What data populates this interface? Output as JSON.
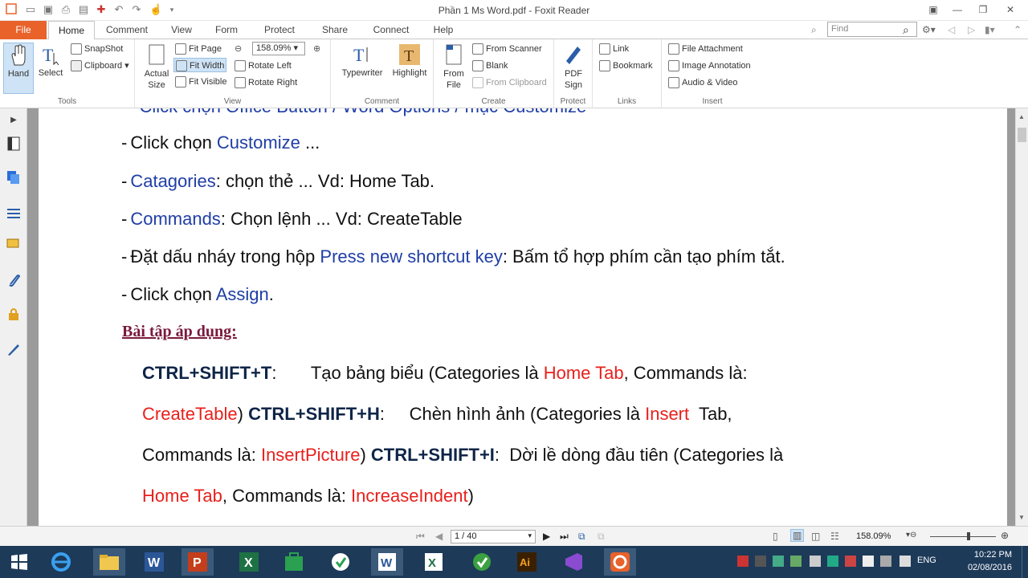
{
  "window": {
    "title": "Phần 1 Ms Word.pdf - Foxit Reader"
  },
  "tabs": [
    "File",
    "Home",
    "Comment",
    "View",
    "Form",
    "Protect",
    "Share",
    "Connect",
    "Help"
  ],
  "search": {
    "placeholder": "Find"
  },
  "ribbon": {
    "tools": {
      "label": "Tools",
      "hand": "Hand",
      "select": "Select",
      "snapshot": "SnapShot",
      "clipboard": "Clipboard"
    },
    "view": {
      "label": "View",
      "actual_size": "Actual Size",
      "fit_page": "Fit Page",
      "fit_width": "Fit Width",
      "fit_visible": "Fit Visible",
      "zoom": "158.09%",
      "rotate_left": "Rotate Left",
      "rotate_right": "Rotate Right"
    },
    "comment": {
      "label": "Comment",
      "typewriter": "Typewriter",
      "highlight": "Highlight"
    },
    "create": {
      "label": "Create",
      "from_file": "From File",
      "from_scanner": "From Scanner",
      "blank": "Blank",
      "from_clipboard": "From Clipboard"
    },
    "protect": {
      "label": "Protect",
      "pdf_sign": "PDF Sign"
    },
    "links": {
      "label": "Links",
      "link": "Link",
      "bookmark": "Bookmark"
    },
    "insert": {
      "label": "Insert",
      "file_attachment": "File Attachment",
      "image_annotation": "Image Annotation",
      "audio_video": "Audio & Video"
    }
  },
  "document": {
    "partial_top": "Click chọn Office Button / Word Options / mục Customize",
    "items": [
      {
        "bullet": "-",
        "parts": [
          {
            "t": "Click chọn ",
            "c": "k"
          },
          {
            "t": "Customize",
            "c": "b"
          },
          {
            "t": " ...",
            "c": "k"
          }
        ]
      },
      {
        "bullet": "-",
        "parts": [
          {
            "t": "Catagories",
            "c": "b"
          },
          {
            "t": ": chọn thẻ ... Vd: Home Tab.",
            "c": "k"
          }
        ]
      },
      {
        "bullet": "-",
        "parts": [
          {
            "t": "Commands",
            "c": "b"
          },
          {
            "t": ": Chọn lệnh ... Vd: CreateTable",
            "c": "k"
          }
        ]
      },
      {
        "bullet": "-",
        "parts": [
          {
            "t": "Đặt dấu nháy trong hộp ",
            "c": "k"
          },
          {
            "t": "Press new shortcut key",
            "c": "b"
          },
          {
            "t": ": Bấm tổ hợp phím cần tạo phím tắt.",
            "c": "k"
          }
        ]
      },
      {
        "bullet": "-",
        "parts": [
          {
            "t": "Click chọn ",
            "c": "k"
          },
          {
            "t": "Assign",
            "c": "b"
          },
          {
            "t": ".",
            "c": "k"
          }
        ]
      }
    ],
    "heading": "Bài tập áp dụng:",
    "exercise_lines": [
      [
        {
          "t": "CTRL+SHIFT+T",
          "c": "s"
        },
        {
          "t": ":       Tạo bảng biểu (Categories là ",
          "c": "k"
        },
        {
          "t": "Home Tab",
          "c": "r"
        },
        {
          "t": ", Commands là:",
          "c": "k"
        }
      ],
      [
        {
          "t": "CreateTable",
          "c": "r"
        },
        {
          "t": ") ",
          "c": "k"
        },
        {
          "t": "CTRL+SHIFT+H",
          "c": "s"
        },
        {
          "t": ":     Chèn hình ảnh (Categories là ",
          "c": "k"
        },
        {
          "t": "Insert",
          "c": "r"
        },
        {
          "t": "  Tab,",
          "c": "k"
        }
      ],
      [
        {
          "t": "Commands là: ",
          "c": "k"
        },
        {
          "t": "InsertPicture",
          "c": "r"
        },
        {
          "t": ") ",
          "c": "k"
        },
        {
          "t": "CTRL+SHIFT+I",
          "c": "s"
        },
        {
          "t": ":  Dời lề dòng đầu tiên (Categories là",
          "c": "k"
        }
      ],
      [
        {
          "t": "Home Tab",
          "c": "r"
        },
        {
          "t": ", Commands là: ",
          "c": "k"
        },
        {
          "t": "IncreaseIndent",
          "c": "r"
        },
        {
          "t": ")",
          "c": "k"
        }
      ]
    ]
  },
  "status": {
    "page": "1 / 40",
    "zoom": "158.09%"
  },
  "tray": {
    "lang": "ENG",
    "time": "10:22 PM",
    "date": "02/08/2016"
  },
  "colors": {
    "accent": "#e8622a",
    "link_blue": "#1f3ea6",
    "red": "#e8201c",
    "heading": "#7a1a3c",
    "taskbar": "#1d3a59"
  }
}
